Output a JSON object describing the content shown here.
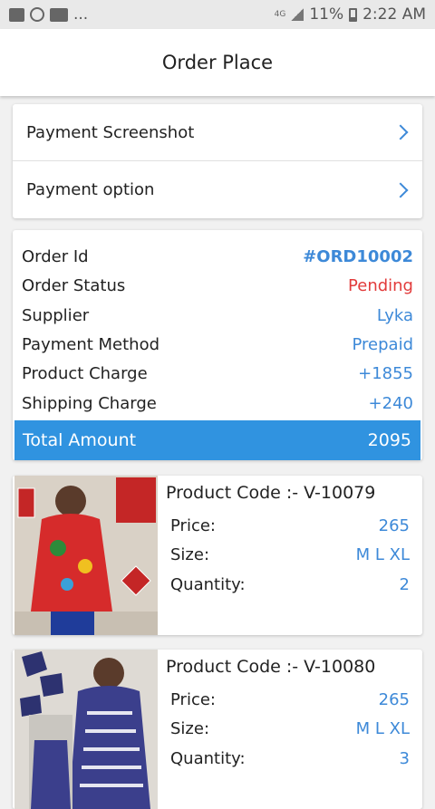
{
  "status_bar": {
    "overflow": "...",
    "network": "4G",
    "battery": "11%",
    "time": "2:22 AM"
  },
  "header": {
    "title": "Order Place"
  },
  "options": [
    {
      "label": "Payment Screenshot",
      "icon": "chevron-right-icon"
    },
    {
      "label": "Payment option",
      "icon": "chevron-right-icon"
    }
  ],
  "order": {
    "rows": [
      {
        "label": "Order Id",
        "value": "#ORD10002"
      },
      {
        "label": "Order Status",
        "value": "Pending"
      },
      {
        "label": "Supplier",
        "value": "Lyka"
      },
      {
        "label": "Payment Method",
        "value": "Prepaid"
      },
      {
        "label": "Product Charge",
        "value": "+1855"
      },
      {
        "label": "Shipping Charge",
        "value": "+240"
      }
    ],
    "total_label": "Total Amount",
    "total_value": "2095"
  },
  "products": [
    {
      "code": "Product Code :- V-10079",
      "price_label": "Price:",
      "price": "265",
      "size_label": "Size:",
      "size": "M L XL",
      "qty_label": "Quantity:",
      "qty": "2"
    },
    {
      "code": "Product Code :- V-10080",
      "price_label": "Price:",
      "price": "265",
      "size_label": "Size:",
      "size": "M L XL",
      "qty_label": "Quantity:",
      "qty": "3"
    }
  ],
  "colors": {
    "accent": "#3d89d8",
    "total_bar": "#3093e0",
    "pending": "#e23b3b"
  }
}
